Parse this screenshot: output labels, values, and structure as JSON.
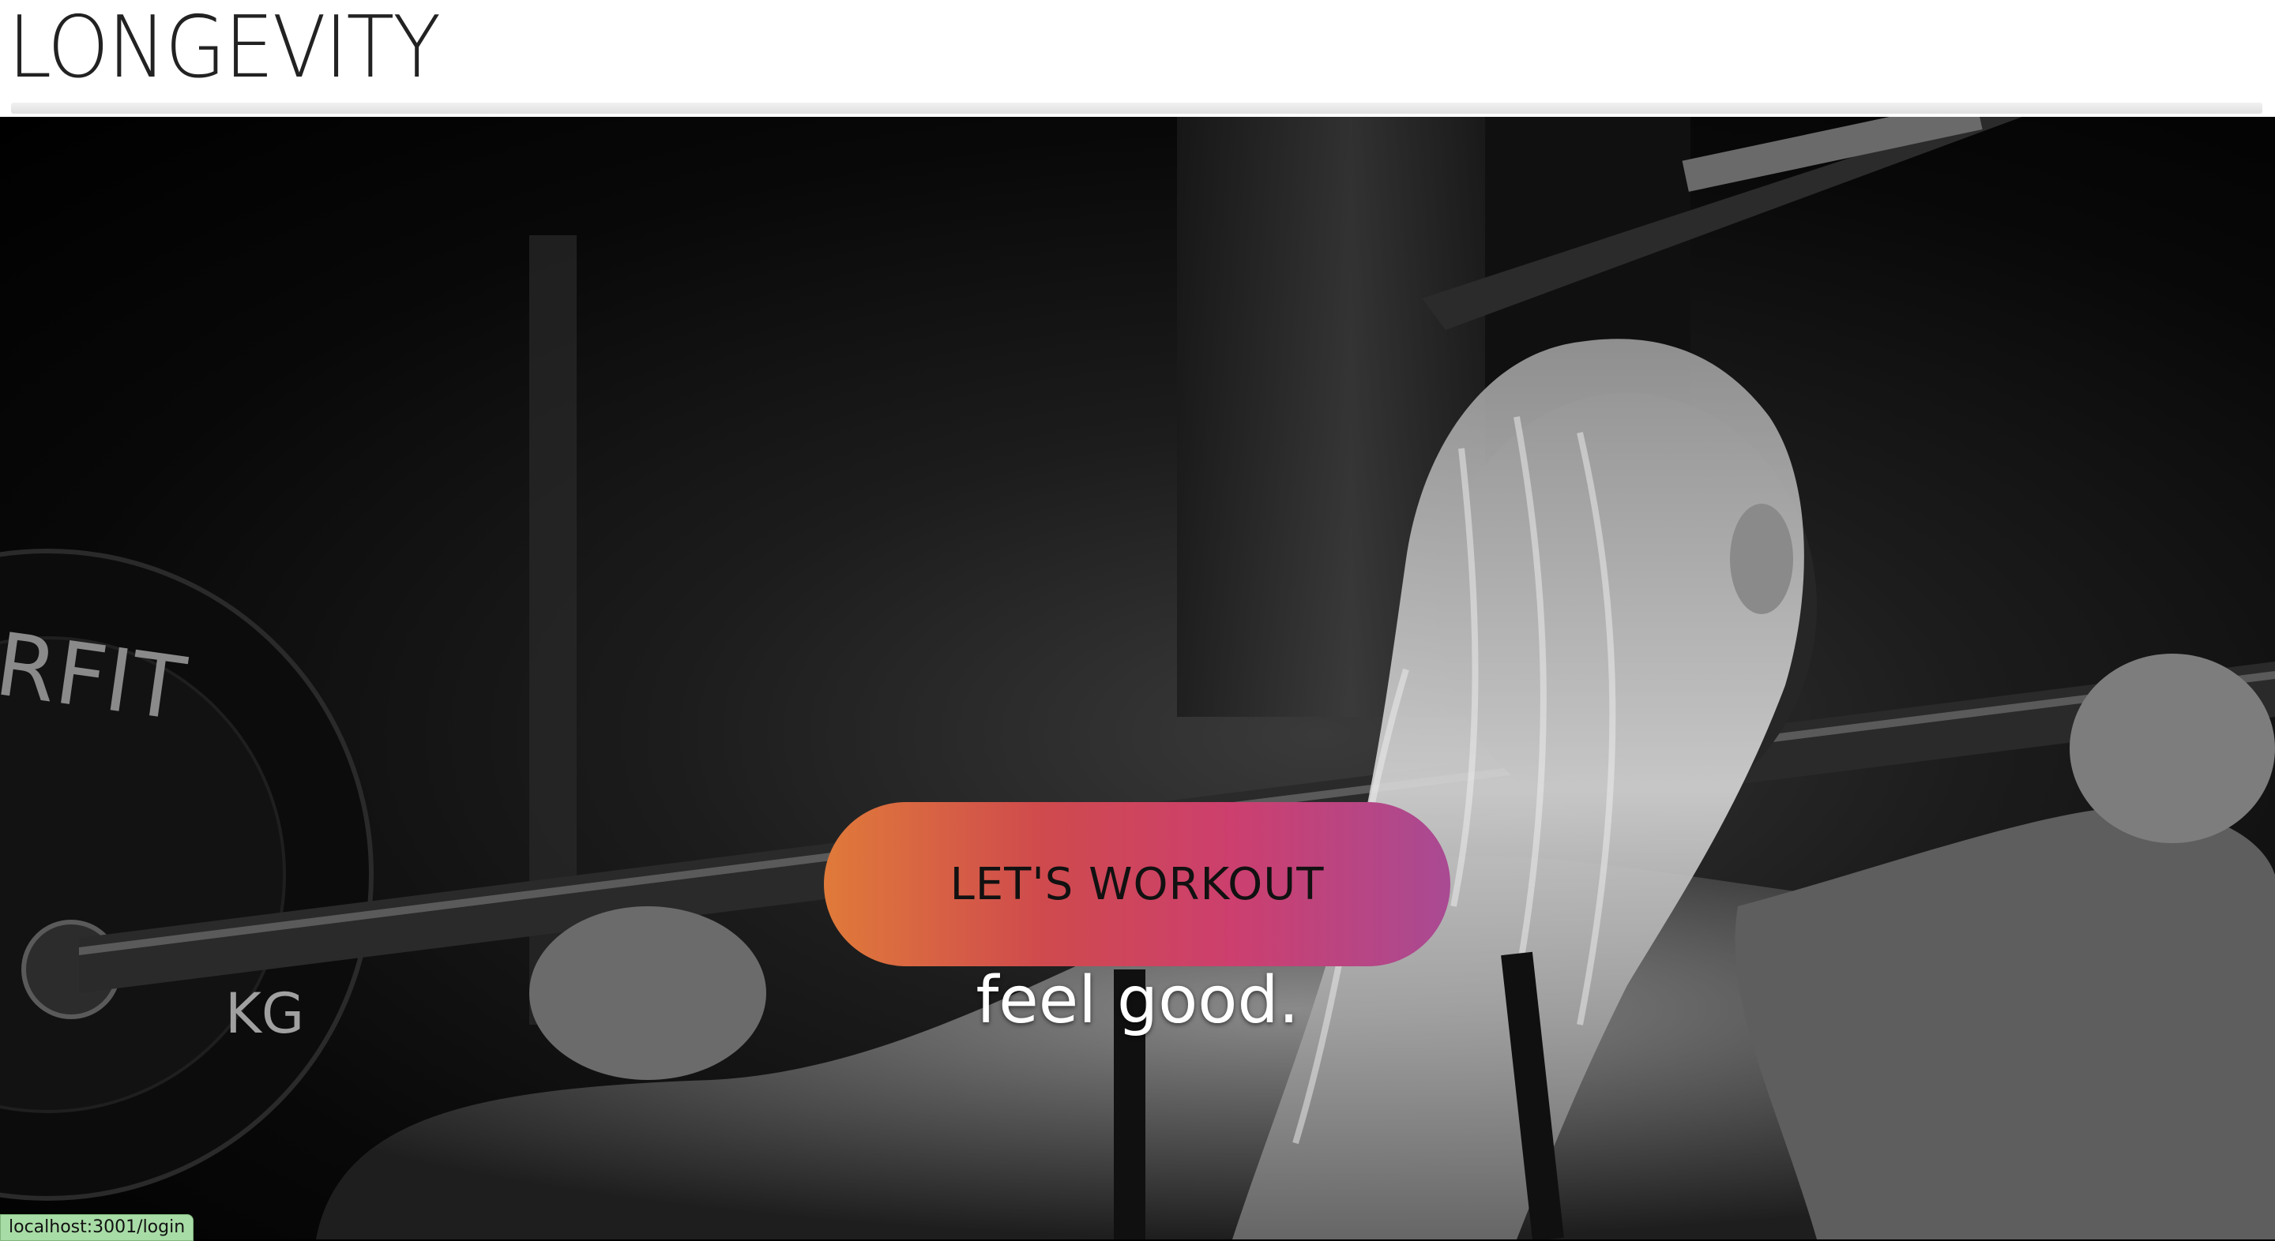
{
  "header": {
    "logo_text": "LONGEVITY"
  },
  "hero": {
    "image_alt": "Woman lifting barbell on shoulders in gym, black and white",
    "plate_text": "RFIT",
    "plate_unit": "KG",
    "cta_label": "LET'S WORKOUT",
    "tagline": "feel good."
  },
  "status_bar": {
    "link_url": "localhost:3001/login"
  },
  "colors": {
    "cta_gradient_start": "#e07a3a",
    "cta_gradient_mid": "#cc3f6e",
    "cta_gradient_end": "#a94a93",
    "status_bg": "#a8dca6"
  }
}
